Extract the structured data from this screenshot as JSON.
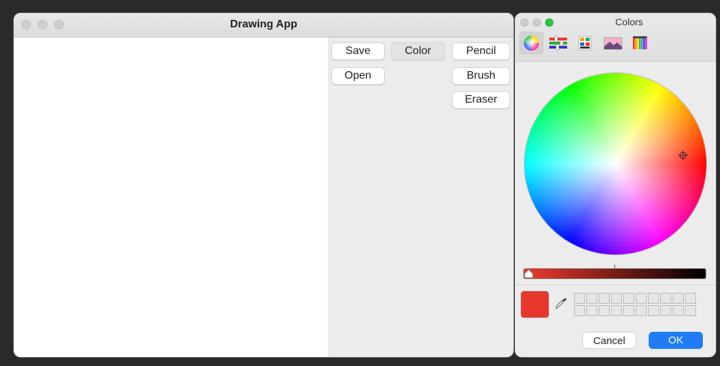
{
  "window": {
    "title": "Drawing App",
    "buttons": {
      "save": "Save",
      "open": "Open",
      "color": "Color",
      "pencil": "Pencil",
      "brush": "Brush",
      "eraser": "Eraser"
    }
  },
  "colors_panel": {
    "title": "Colors",
    "tools": [
      "color-wheel-icon",
      "color-sliders-icon",
      "color-palettes-icon",
      "image-palettes-icon",
      "pencils-icon"
    ],
    "selected_tool": "color-wheel-icon",
    "current_color": "#e8372c",
    "cancel_label": "Cancel",
    "ok_label": "OK",
    "accent": "#1f7cf4"
  }
}
